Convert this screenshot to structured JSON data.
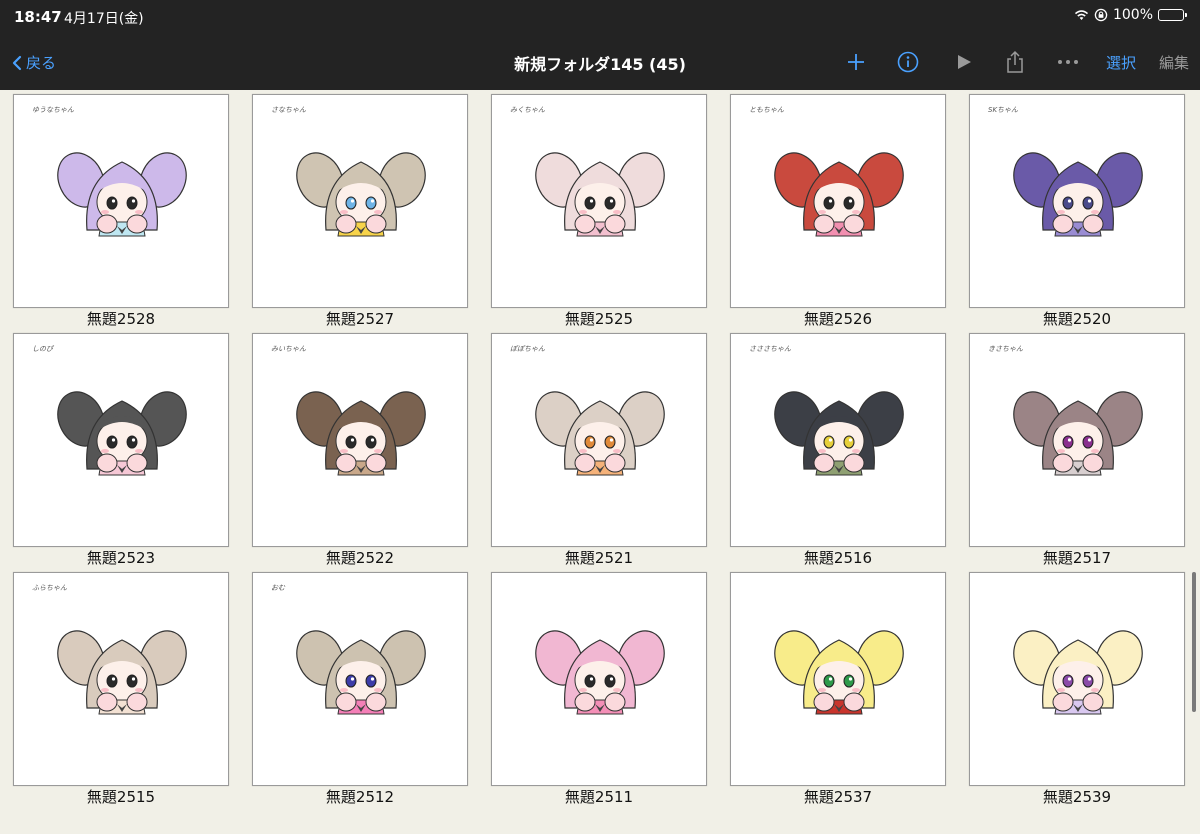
{
  "status": {
    "time": "18:47",
    "date": "4月17日(金)",
    "battery": "100%"
  },
  "nav": {
    "back_label": "戻る",
    "title": "新規フォルダ145 (45)",
    "select_label": "選択",
    "edit_label": "編集"
  },
  "items": [
    {
      "label": "無題2528",
      "note": "ゆうなちゃん",
      "hair": "#cdb9ea",
      "eye": "#2a2a2a",
      "accent": "#bfe7f2"
    },
    {
      "label": "無題2527",
      "note": "さなちゃん",
      "hair": "#cfc4b2",
      "eye": "#6fb4e6",
      "accent": "#f7d34a"
    },
    {
      "label": "無題2525",
      "note": "みくちゃん",
      "hair": "#efdcdc",
      "eye": "#2a2a2a",
      "accent": "#f3c0cf"
    },
    {
      "label": "無題2526",
      "note": "ともちゃん",
      "hair": "#c94a3e",
      "eye": "#2a2a2a",
      "accent": "#f28fb0"
    },
    {
      "label": "無題2520",
      "note": "SKちゃん",
      "hair": "#6a5aa8",
      "eye": "#4a4a8a",
      "accent": "#9a8cd3"
    },
    {
      "label": "無題2523",
      "note": "しのぴ",
      "hair": "#555555",
      "eye": "#2a2a2a",
      "accent": "#f6c8d6"
    },
    {
      "label": "無題2522",
      "note": "みいちゃん",
      "hair": "#7a6250",
      "eye": "#2a2a2a",
      "accent": "#c9a88a"
    },
    {
      "label": "無題2521",
      "note": "ぽぽちゃん",
      "hair": "#dcd0c6",
      "eye": "#e08a3a",
      "accent": "#f5b27a"
    },
    {
      "label": "無題2516",
      "note": "さささちゃん",
      "hair": "#3c3f46",
      "eye": "#e6cf3a",
      "accent": "#8fa072"
    },
    {
      "label": "無題2517",
      "note": "きさちゃん",
      "hair": "#9b8486",
      "eye": "#8a2f8f",
      "accent": "#d8cfd0"
    },
    {
      "label": "無題2515",
      "note": "ふらちゃん",
      "hair": "#d9cbbd",
      "eye": "#2a2a2a",
      "accent": "#f3e1d3"
    },
    {
      "label": "無題2512",
      "note": "おむ",
      "hair": "#cdc2b0",
      "eye": "#3c3ca8",
      "accent": "#f47fb7"
    },
    {
      "label": "無題2511",
      "note": "",
      "hair": "#f1b7d2",
      "eye": "#2a2a2a",
      "accent": "#f48fb7"
    },
    {
      "label": "無題2537",
      "note": "",
      "hair": "#f8ec8a",
      "eye": "#2e9a4a",
      "accent": "#c8342c"
    },
    {
      "label": "無題2539",
      "note": "",
      "hair": "#fbf0c4",
      "eye": "#8a4aa8",
      "accent": "#d9c8f0"
    }
  ],
  "icons": {
    "back": "chevron-left-icon",
    "add": "plus-icon",
    "info": "info-icon",
    "play": "play-icon",
    "share": "share-icon",
    "more": "ellipsis-icon"
  },
  "colors": {
    "accent": "#4aa1ff",
    "bar": "#232323",
    "background": "#f1f0e7"
  }
}
